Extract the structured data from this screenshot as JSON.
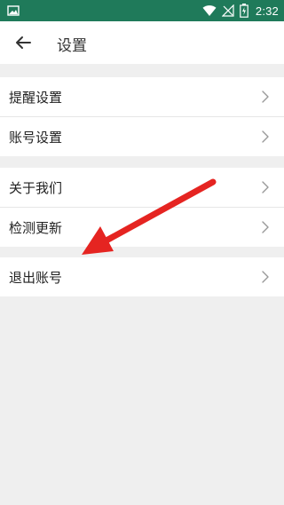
{
  "status_bar": {
    "time": "2:32",
    "icons": [
      "image-icon",
      "wifi-icon",
      "no-signal-icon",
      "battery-icon"
    ]
  },
  "header": {
    "title": "设置",
    "back_icon": "back-arrow-icon"
  },
  "sections": [
    {
      "items": [
        {
          "label": "提醒设置"
        },
        {
          "label": "账号设置"
        }
      ]
    },
    {
      "items": [
        {
          "label": "关于我们"
        },
        {
          "label": "检测更新"
        }
      ]
    },
    {
      "items": [
        {
          "label": "退出账号"
        }
      ]
    }
  ],
  "colors": {
    "status_bar": "#1f7a5a",
    "background": "#efefef",
    "annotation_arrow": "#e52421"
  }
}
